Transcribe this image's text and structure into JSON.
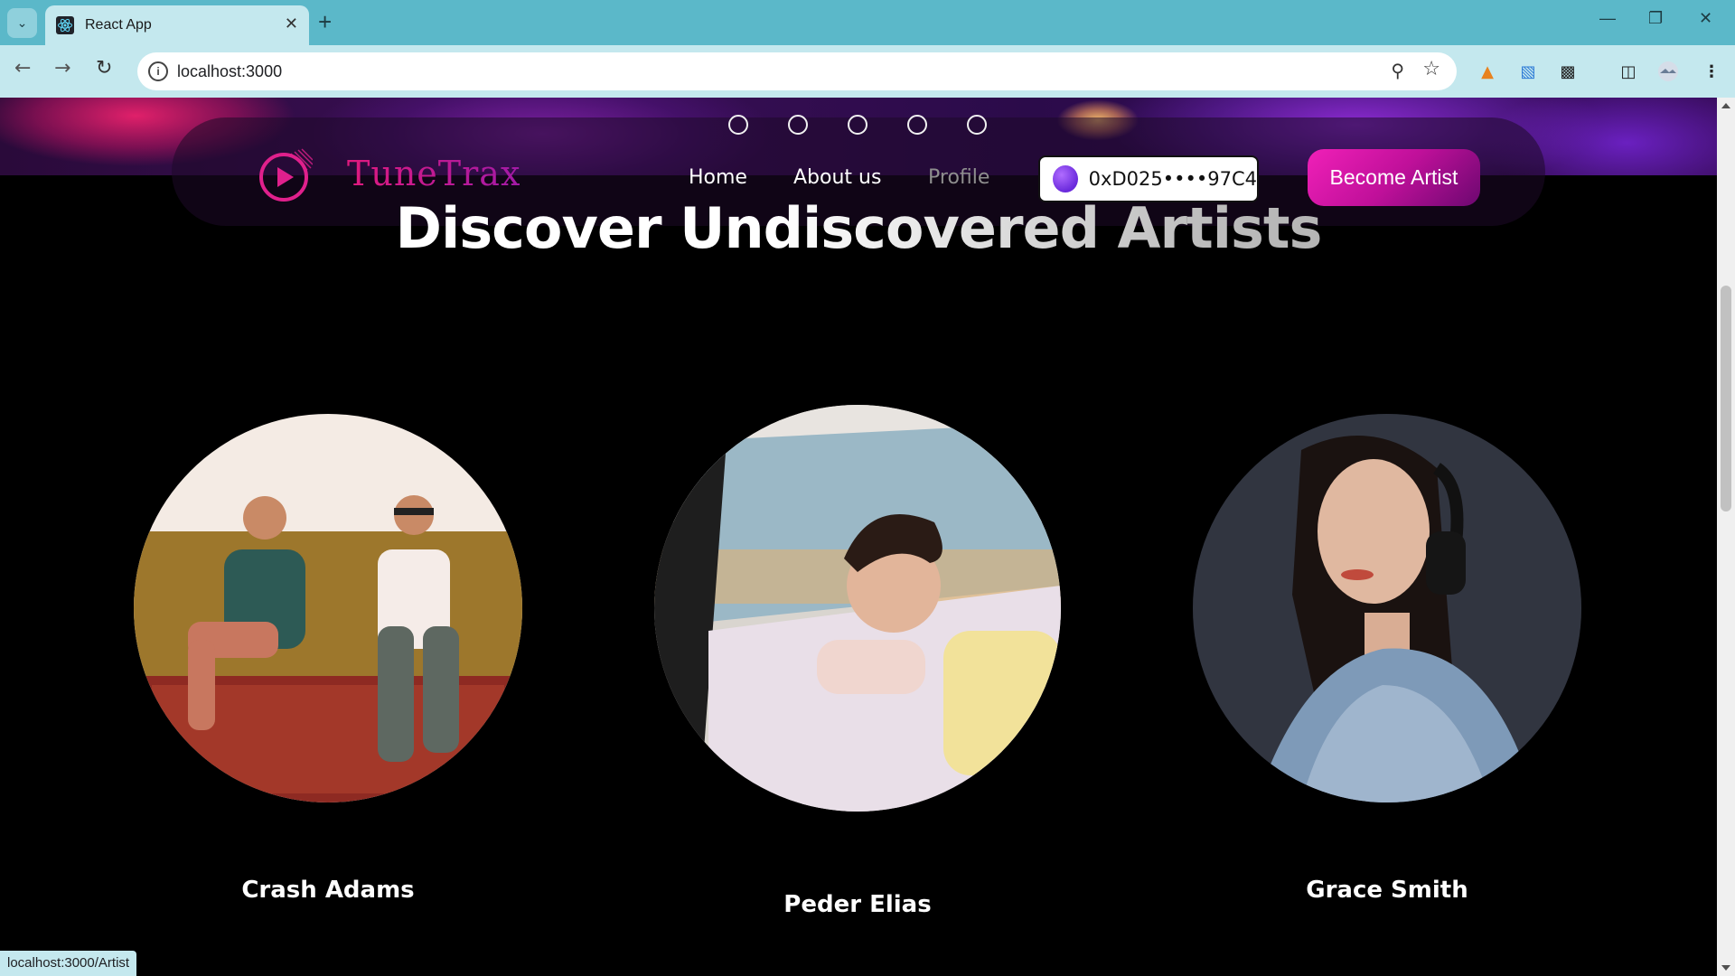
{
  "browser": {
    "tab_title": "React App",
    "url": "localhost:3000",
    "status_url": "localhost:3000/Artist"
  },
  "brand": {
    "name": "TuneTrax",
    "accent": "#e01a7e"
  },
  "nav": {
    "links": [
      {
        "label": "Home",
        "active": false
      },
      {
        "label": "About us",
        "active": false
      },
      {
        "label": "Profile",
        "active": true
      }
    ],
    "wallet_address": "0xD025••••97C4",
    "become_artist_label": "Become Artist"
  },
  "carousel": {
    "dot_count": 5
  },
  "page": {
    "headline": "Discover Undiscovered Artists"
  },
  "artists": [
    {
      "name": "Crash Adams"
    },
    {
      "name": "Peder Elias"
    },
    {
      "name": "Grace Smith"
    }
  ]
}
